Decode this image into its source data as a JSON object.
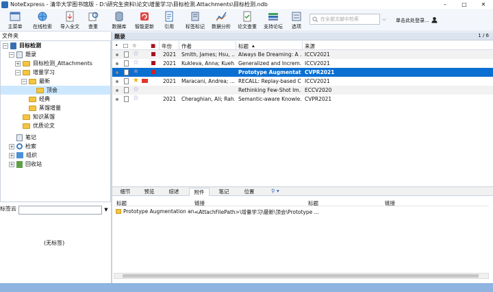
{
  "window": {
    "title": "NoteExpress - 清华大学图书馆版 - D:\\研究生资料\\论文\\增量学习\\目标检测.Attachments\\目标检测.ndb"
  },
  "toolbar": {
    "buttons": [
      {
        "label": "主菜单",
        "icon": "menu-icon"
      },
      {
        "label": "在线检索",
        "icon": "online-search-icon"
      },
      {
        "label": "导入全文",
        "icon": "import-icon"
      },
      {
        "label": "查重",
        "icon": "dedupe-icon"
      },
      {
        "label": "数据库",
        "icon": "database-icon"
      },
      {
        "label": "智能更新",
        "icon": "update-icon"
      },
      {
        "label": "引用",
        "icon": "cite-icon"
      },
      {
        "label": "标签标记",
        "icon": "tag-icon"
      },
      {
        "label": "数据分析",
        "icon": "analysis-icon"
      },
      {
        "label": "论文查重",
        "icon": "paper-check-icon"
      },
      {
        "label": "支持论坛",
        "icon": "forum-icon"
      },
      {
        "label": "选项",
        "icon": "options-icon"
      }
    ],
    "search_placeholder": "在全部文献中检索",
    "login_label": "单击此处登录..."
  },
  "left": {
    "header": "文件夹",
    "tree": [
      {
        "label": "目标检测",
        "bold": true,
        "icon": "database-icon"
      },
      {
        "label": "题录",
        "icon": "note-icon"
      },
      {
        "label": "目标检测_Attachments",
        "icon": "folder-icon"
      },
      {
        "label": "增量学习",
        "icon": "folder-icon"
      },
      {
        "label": "最新",
        "icon": "folder-icon"
      },
      {
        "label": "顶会",
        "icon": "folder-icon"
      },
      {
        "label": "经典",
        "icon": "folder-icon"
      },
      {
        "label": "蒸馏增量",
        "icon": "folder-icon"
      },
      {
        "label": "知识蒸馏",
        "icon": "folder-icon"
      },
      {
        "label": "优质论文",
        "icon": "folder-icon"
      },
      {
        "label": "笔记",
        "icon": "note-icon"
      },
      {
        "label": "检索",
        "icon": "search-icon"
      },
      {
        "label": "组织",
        "icon": "organize-icon"
      },
      {
        "label": "回收站",
        "icon": "recycle-icon"
      }
    ],
    "tag_label": "标签云",
    "tag_empty": "(无标签)"
  },
  "grid": {
    "title": "题录",
    "page": "1 / 6",
    "columns": [
      "年份",
      "作者",
      "标题",
      "来源"
    ],
    "rows": [
      {
        "year": "2021",
        "author": "Smith, James; Hsu, ...",
        "title": "Always Be Dreaming: A ...",
        "source": "ICCV2021",
        "flag": true
      },
      {
        "year": "2021",
        "author": "Kukleva, Anna; Kueh...",
        "title": "Generalized and Increm...",
        "source": "ICCV2021",
        "flag": true
      },
      {
        "year": "",
        "author": "",
        "title": "Prototype Augmentatio",
        "source": "CVPR2021",
        "flag": true
      },
      {
        "year": "2021",
        "author": "Maracani, Andrea; ...",
        "title": "RECALL: Replay-based C...",
        "source": "ICCV2021",
        "flag": true
      },
      {
        "year": "",
        "author": "",
        "title": "Rethinking Few-Shot Im...",
        "source": "ECCV2020",
        "flag": false
      },
      {
        "year": "2021",
        "author": "Cheraghian, Ali; Rah...",
        "title": "Semantic-aware Knowle...",
        "source": "CVPR2021",
        "flag": false
      }
    ]
  },
  "bottom": {
    "tabs": [
      "细节",
      "预览",
      "综述",
      "附件",
      "笔记",
      "位置"
    ],
    "active_tab": "附件",
    "att_columns": [
      "标题",
      "链接",
      "标题",
      "链接"
    ],
    "att_rows": [
      {
        "title": "Prototype Augmentation an...",
        "link": "<AttachFilePath>\\增量学习\\最新\\顶会\\Prototype ..."
      }
    ]
  }
}
